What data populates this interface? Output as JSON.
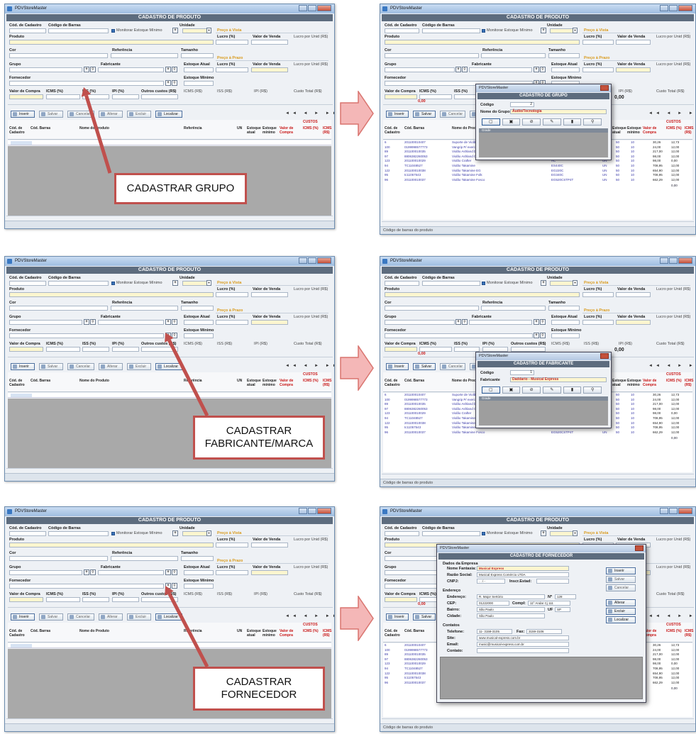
{
  "app": {
    "window_title": "PDVStoreMaster",
    "header": "CADASTRO DE PRODUTO"
  },
  "form": {
    "cod_cadastro": "Cód. de Cadastro",
    "cod_barras": "Código de Barras",
    "monitorar": "Monitorar Estoque Mínimo",
    "unidade": "Unidade",
    "preco_vista": "Preço à Vista",
    "produto": "Produto",
    "lucro": "Lucro (%)",
    "valor_venda": "Valor de Venda",
    "lucro_unid": "Lucro por Unid (R$)",
    "cor": "Cor",
    "referencia": "Referência",
    "tamanho": "Tamanho",
    "preco_prazo": "Preço à Prazo",
    "grupo": "Grupo",
    "fabricante": "Fabricante",
    "estoque_atual": "Estoque Atual",
    "fornecedor": "Fornecedor",
    "estoque_minimo": "Estoque Mínimo",
    "valor_compra": "Valor de Compra",
    "icms": "ICMS (%)",
    "iss": "ISS (%)",
    "ipi": "IPI (%)",
    "outros": "Outros custos (R$)",
    "icms_rs": "ICMS (R$)",
    "iss_rs": "ISS (R$)",
    "ipi_rs": "IPI (R$)",
    "custo_total": "Custo Total (R$)",
    "zero": "0,00"
  },
  "toolbar": {
    "inserir": "Inserir",
    "salvar": "Salvar",
    "cancelar": "Cancelar",
    "alterar": "Alterar",
    "excluir": "Excluir",
    "localizar": "Localizar",
    "nav": "◄◄ ◄ ► ►►"
  },
  "grid": {
    "custos": "CUSTOS",
    "cols": [
      "Cód. de Cadastro",
      "Cód. Barras",
      "Nome do Produto",
      "Referência",
      "UN",
      "Estoque atual",
      "Estoque mínimo",
      "Valor de Compra",
      "ICMS (%)",
      "ICMS (R$)"
    ],
    "rows": [
      [
        "6",
        "201100010407",
        "Suporte de Violão e guitarra com Trava",
        "ASSPV",
        "UN",
        "50",
        "10",
        "30,26",
        "12,73"
      ],
      [
        "100",
        "0199998577773",
        "Vangrip P/ exercício",
        "",
        "UN",
        "50",
        "10",
        "24,00",
        "12,00"
      ],
      [
        "89",
        "201100010035",
        "Violão Ashland by Crafter",
        "ADC 10 NT",
        "UN",
        "50",
        "10",
        "217,00",
        "12,00"
      ],
      [
        "97",
        "8806382260053",
        "Violão Ashland Crafter",
        "AC - 10/ Pan",
        "UN",
        "50",
        "10",
        "98,00",
        "12,00"
      ],
      [
        "123",
        "201100010029",
        "Violão Crafter",
        "AC",
        "UN",
        "50",
        "10",
        "98,00",
        "0,00"
      ],
      [
        "94",
        "TC11048527",
        "Violão Takamine",
        "ES440C",
        "UN",
        "50",
        "10",
        "708,95",
        "12,00"
      ],
      [
        "122",
        "201100010038",
        "Violão Takamine EG",
        "EG220C",
        "UN",
        "50",
        "10",
        "654,90",
        "12,00"
      ],
      [
        "95",
        "tc11057543",
        "Violão Takamine Folk",
        "EG340C",
        "UN",
        "50",
        "10",
        "708,95",
        "12,00"
      ],
      [
        "96",
        "201100010037",
        "Violão Takamine Fosco",
        "EG520CSTP4T",
        "UN",
        "50",
        "10",
        "662,29",
        "12,00"
      ]
    ],
    "total": "0,00"
  },
  "status": "Código de barras do produto",
  "dialogs": {
    "grupo": {
      "title": "CADASTRO DE GRUPO",
      "codigo_lbl": "Código",
      "codigo_val": "2",
      "nome_lbl": "Nome do Grupo",
      "nome_val": "Áudio/Tecnologia",
      "grade": "Grade"
    },
    "fabricante": {
      "title": "CADASTRO DE FABRICANTE",
      "codigo_lbl": "Código",
      "codigo_val": "1",
      "nome_lbl": "Fabricante",
      "nome_val": "Daddario - Musical Express",
      "grade": "Grade"
    },
    "fornecedor": {
      "title": "CADASTRO DE FORNECEDOR",
      "section_empresa": "Dados da Empresa",
      "fields": [
        [
          "Nome Fantasia:",
          "Musical Express"
        ],
        [
          "Razão Social:",
          "Musical Express Comércio LTDA"
        ],
        [
          "CNPJ:",
          ". . / -"
        ],
        [
          "Endereço",
          ""
        ],
        [
          "Endereço:",
          "R. Major Sertório"
        ],
        [
          "CEP:",
          "01222000"
        ],
        [
          "Bairro:",
          "São Paulo"
        ],
        [
          "Cidade:",
          "São Paulo"
        ],
        [
          "Contatos",
          ""
        ],
        [
          "Telefone:",
          "11- 3159-3105"
        ],
        [
          "Site:",
          "www.musical-express.com.br"
        ],
        [
          "Email:",
          "music@musical-express.com.br"
        ],
        [
          "Contato:",
          ""
        ]
      ],
      "insc": "Inscr.Estad:",
      "num_lbl": "Nº",
      "num_val": "128",
      "compl_lbl": "Compl:",
      "compl_val": "11º Andar Cj 111",
      "uf_lbl": "UF",
      "uf_val": "SP",
      "fax_lbl": "Fax:",
      "fax_val": "3159-3106",
      "side_btns": [
        "Inserir",
        "Salvar",
        "Cancelar",
        "Alterar",
        "Excluir",
        "Localizar"
      ]
    }
  },
  "callouts": {
    "c1": "CADASTRAR GRUPO",
    "c2a": "CADASTRAR",
    "c2b": "FABRICANTE/MARCA",
    "c3a": "CADASTRAR",
    "c3b": "FORNECEDOR"
  },
  "colors": {
    "callout_border": "#c0504d",
    "arrow_fill": "#f4b7b7",
    "header_bg": "#5d6c7e"
  }
}
